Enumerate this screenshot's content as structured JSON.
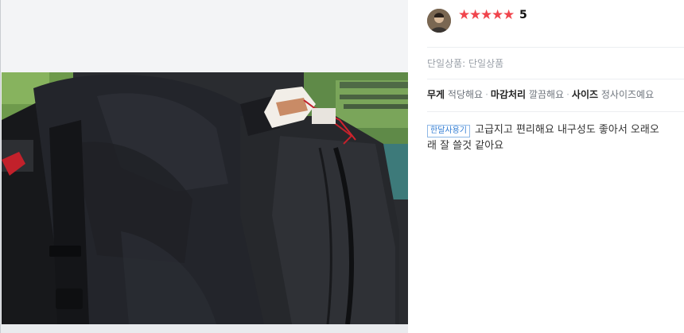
{
  "photo_viewer": {
    "image_description_icon": "photo-backpack"
  },
  "review": {
    "avatar_icon": "user-avatar",
    "rating": {
      "stars": 5,
      "max": 5,
      "score_text": "5",
      "star_color": "#f0454d"
    },
    "product_option": "단일상품: 단일상품",
    "attributes": [
      {
        "key": "무게",
        "value": "적당해요"
      },
      {
        "key": "마감처리",
        "value": "깔끔해요"
      },
      {
        "key": "사이즈",
        "value": "정사이즈예요"
      }
    ],
    "usage_tag": "한달사용기",
    "body": "고급지고 편리해요 내구성도 좋아서 오래오래 잘 쓸것 같아요",
    "tag_color": "#2f7bd3"
  }
}
